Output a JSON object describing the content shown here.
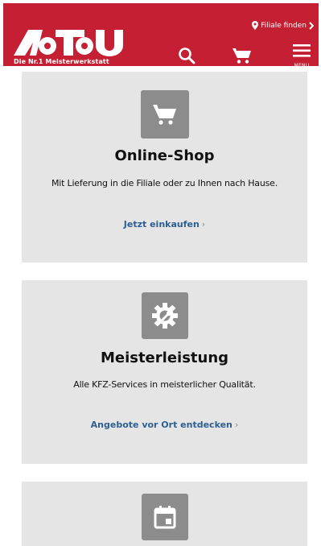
{
  "header": {
    "brand_color": "#c41f32",
    "logo_text": "A.T.U",
    "tagline": "Die Nr.1 Meisterwerkstatt",
    "store_finder_label": "Filiale finden",
    "menu_label": "MENU",
    "icons": [
      "location-pin-icon",
      "chevron-right-icon",
      "search-icon",
      "cart-icon",
      "hamburger-menu-icon"
    ]
  },
  "cards": [
    {
      "icon": "cart-icon",
      "title": "Online-Shop",
      "text": "Mit Lieferung in die Filiale oder zu Ihnen nach Hause.",
      "link": "Jetzt einkaufen"
    },
    {
      "icon": "gear-wrench-icon",
      "title": "Meisterleistung",
      "text": "Alle KFZ-Services in meisterlicher Qualität.",
      "link": "Angebote vor Ort entdecken"
    },
    {
      "icon": "calendar-icon"
    }
  ],
  "colors": {
    "card_background": "#e5e5e5",
    "icon_background": "#8c8c8c",
    "link": "#2d5f91"
  }
}
